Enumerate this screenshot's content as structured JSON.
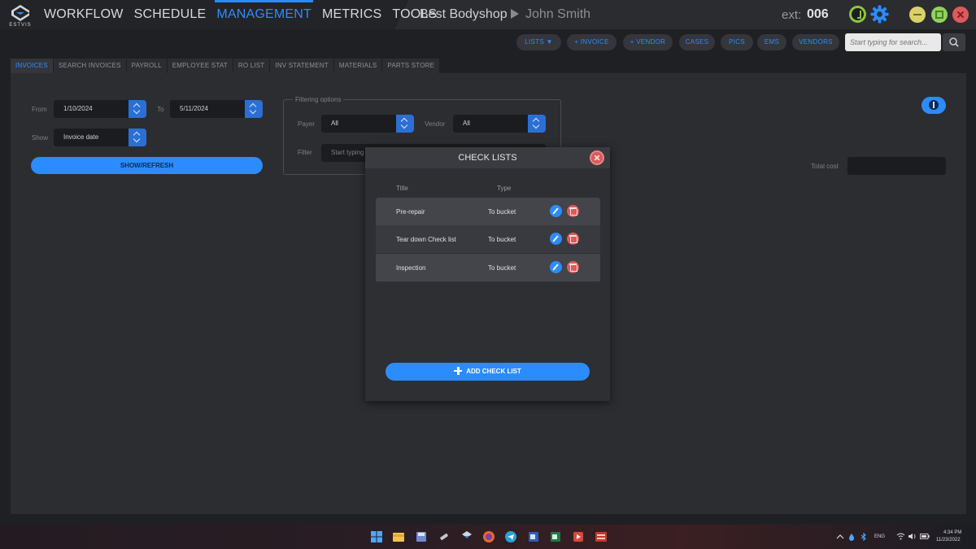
{
  "app": {
    "logo_text": "ESTVIS",
    "nav": [
      "WORKFLOW",
      "SCHEDULE",
      "MANAGEMENT",
      "METRICS",
      "TOOLS"
    ],
    "active_nav": "MANAGEMENT",
    "shop_name": "Best Bodyshop",
    "user_name": "John Smith",
    "ext_label": "ext:",
    "ext_value": "006"
  },
  "toolbar": {
    "lists": "LISTS ▼",
    "invoice": "+ INVOICE",
    "vendor": "+ VENDOR",
    "cases": "CASES",
    "pics": "PICS",
    "ems": "EMS",
    "vendors": "VENDORS",
    "search_placeholder": "Start typing for search..."
  },
  "tabs": [
    "INVOICES",
    "SEARCH INVOICES",
    "PAYROLL",
    "EMPLOYEE STAT",
    "RO LIST",
    "INV STATEMENT",
    "MATERIALS",
    "PARTS STORE"
  ],
  "active_tab": "INVOICES",
  "form": {
    "from_label": "From",
    "from_value": "1/10/2024",
    "to_label": "To",
    "to_value": "5/11/2024",
    "show_label": "Show",
    "show_value": "Invoice date",
    "refresh_label": "SHOW/REFRESH",
    "filtering_title": "Filtering options",
    "payer_label": "Payer",
    "payer_value": "All",
    "vendor_label": "Vendor",
    "vendor_value": "All",
    "filter_label": "Filter",
    "filter_placeholder": "Start typing",
    "total_cost_label": "Total cost"
  },
  "modal": {
    "title": "CHECK LISTS",
    "col_title": "Title",
    "col_type": "Type",
    "rows": [
      {
        "title": "Pre-repair",
        "type": "To bucket"
      },
      {
        "title": "Tear down Check list",
        "type": "To bucket"
      },
      {
        "title": "Inspection",
        "type": "To bucket"
      }
    ],
    "add_label": "ADD CHECK LIST"
  },
  "taskbar": {
    "lang": "ENG",
    "time": "4:34 PM",
    "date": "11/23/2022"
  },
  "colors": {
    "accent": "#2b8cff",
    "danger": "#d95b5b",
    "panel": "#2c2d31"
  }
}
